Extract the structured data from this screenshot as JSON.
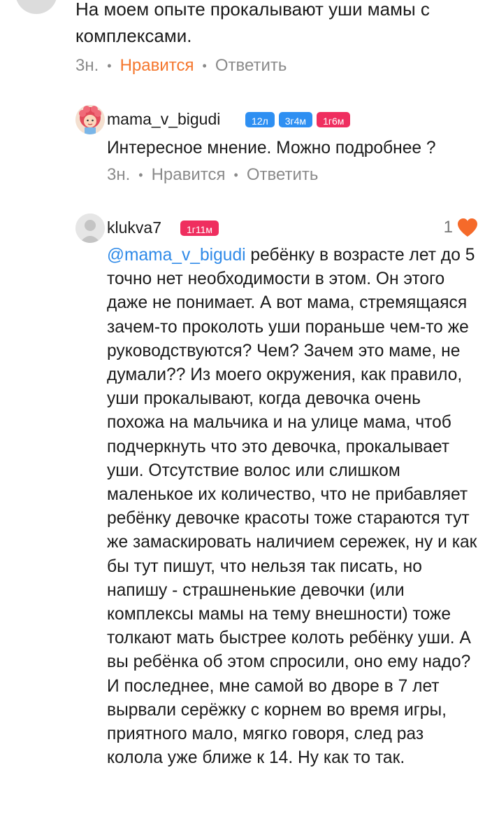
{
  "comments": [
    {
      "text": "На моем опыте прокалывают уши мамы с комплексами.",
      "time": "3н.",
      "like_label": "Нравится",
      "reply_label": "Ответить"
    },
    {
      "username": "mama_v_bigudi",
      "badges": [
        "12л",
        "3г4м",
        "1г6м"
      ],
      "text": "Интересное мнение. Можно подробнее ?",
      "time": "3н.",
      "like_label": "Нравится",
      "reply_label": "Ответить"
    },
    {
      "username": "klukva7",
      "badges": [
        "1г11м"
      ],
      "likes": "1",
      "mention": "@mama_v_bigudi",
      "text": " ребёнку в возрасте лет до 5 точно нет необходимости в этом. Он этого даже не понимает. А вот мама, стремящаяся зачем-то проколоть уши пораньше чем-то же руководствуются? Чем? Зачем это маме, не думали?? Из моего окружения, как правило, уши прокалывают, когда девочка очень похожа на мальчика и на улице мама, чтоб подчеркнуть что это девочка, прокалывает уши. Отсутствие волос или слишком маленькое их количество, что не прибавляет ребёнку девочке красоты тоже стараются тут же замаскировать наличием сережек, ну и как бы тут пишут, что нельзя так писать, но напишу - страшненькие девочки (или комплексы мамы на тему внешности) тоже толкают мать быстрее колоть ребёнку уши. А вы ребёнка об этом спросили, оно ему надо? И последнее, мне самой во дворе в 7 лет вырвали серёжку с корнем во время игры, приятного мало, мягко говоря, след раз колола уже ближе к 14. Ну как то так."
    }
  ],
  "colors": {
    "badge_blue": "#2e8ff2",
    "badge_pink": "#ef2e5f",
    "liked_orange": "#f5762c",
    "mention_blue": "#2f8ae8",
    "heart_orange": "#f56a2a"
  },
  "icons": {
    "avatar_top": "gray-avatar",
    "avatar_mama": "curly-hair-woman-avatar",
    "avatar_klukva": "default-user-avatar",
    "like_icon": "heart-icon"
  }
}
